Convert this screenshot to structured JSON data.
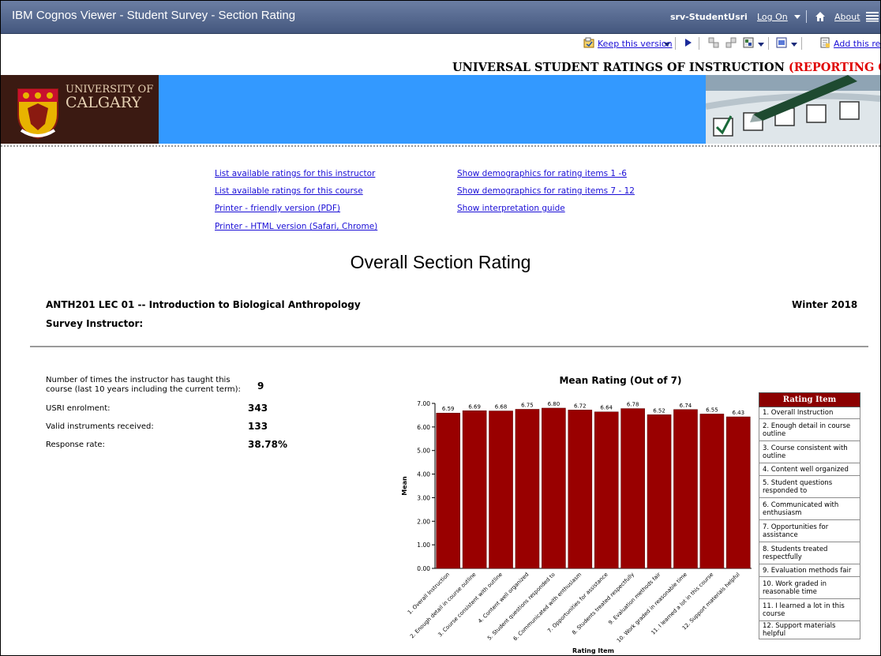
{
  "titlebar": {
    "title": "IBM Cognos Viewer - Student Survey - Section Rating",
    "user": "srv-StudentUsri",
    "logon_label": "Log On",
    "about_label": "About"
  },
  "toolbar": {
    "keep_version_label": "Keep this version",
    "add_report_label": "Add this repo"
  },
  "header": {
    "title_main": "UNIVERSAL STUDENT RATINGS OF INSTRUCTION ",
    "title_red": "(REPORTING ONLY",
    "logo_line1": "UNIVERSITY OF",
    "logo_line2": "CALGARY"
  },
  "links": {
    "left": [
      "List available ratings for this instructor",
      "List available ratings for this course",
      "Printer - friendly version (PDF)",
      "Printer - HTML version (Safari, Chrome)"
    ],
    "right": [
      "Show demographics for rating items 1 -6",
      "Show demographics for rating items 7 - 12",
      "Show interpretation guide"
    ]
  },
  "report": {
    "heading": "Overall Section Rating",
    "course": "ANTH201 LEC 01 -- Introduction to Biological Anthropology",
    "term": "Winter 2018",
    "instructor_label": "Survey Instructor:"
  },
  "stats": {
    "times_taught_label": "Number of times the instructor has taught this course (last 10 years including the current term):",
    "times_taught_value": "9",
    "enrolment_label": "USRI enrolment:",
    "enrolment_value": "343",
    "received_label": "Valid instruments received:",
    "received_value": "133",
    "response_label": "Response rate:",
    "response_value": "38.78%"
  },
  "chart_data": {
    "type": "bar",
    "title": "Mean Rating (Out of 7)",
    "xlabel": "Rating Item",
    "ylabel": "Mean",
    "ylim": [
      0,
      7
    ],
    "yticks": [
      "0.00",
      "1.00",
      "2.00",
      "3.00",
      "4.00",
      "5.00",
      "6.00",
      "7.00"
    ],
    "categories": [
      "1.  Overall Instruction",
      "2.  Enough detail in course outline",
      "3.  Course consistent with outline",
      "4.  Content well organized",
      "5.  Student questions responded to",
      "6.  Communicated with enthusiasm",
      "7.  Opportunities for assistance",
      "8.  Students treated respectfully",
      "9.  Evaluation methods fair",
      "10. Work graded in reasonable time",
      "11. I learned a lot in this course",
      "12. Support materials helpful"
    ],
    "values": [
      6.59,
      6.69,
      6.68,
      6.75,
      6.8,
      6.72,
      6.64,
      6.78,
      6.52,
      6.74,
      6.55,
      6.43
    ],
    "value_labels": [
      "6.59",
      "6.69",
      "6.68",
      "6.75",
      "6.80",
      "6.72",
      "6.64",
      "6.78",
      "6.52",
      "6.74",
      "6.55",
      "6.43"
    ],
    "bar_color": "#990000",
    "grid": false
  },
  "legend": {
    "header": "Rating Item",
    "items": [
      "1.  Overall Instruction",
      "2.  Enough detail in course outline",
      "3.  Course consistent with outline",
      "4.  Content well organized",
      "5.  Student questions responded to",
      "6.  Communicated with enthusiasm",
      "7.  Opportunities for assistance",
      "8.  Students treated respectfully",
      "9.  Evaluation methods fair",
      "10. Work graded in reasonable time",
      "11. I learned a lot in this course",
      "12. Support materials helpful"
    ]
  },
  "colors": {
    "titlebar": "#4f6189",
    "banner": "#3399ff",
    "link": "#1a0ed6",
    "accent_red": "#e00000",
    "bar": "#990000"
  },
  "icons": [
    "home-icon",
    "ibm-icon",
    "keep-version-icon",
    "run-icon",
    "drill-down-icon",
    "drill-up-icon",
    "related-links-icon",
    "view-format-icon",
    "add-report-icon"
  ]
}
